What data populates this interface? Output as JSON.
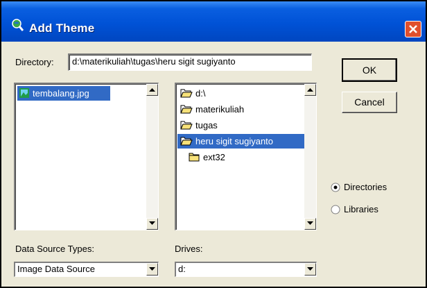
{
  "window": {
    "title": "Add Theme",
    "icon": "globe-search-icon",
    "accent": "#0052d6",
    "close_color": "#e0502d"
  },
  "directory": {
    "label": "Directory:",
    "value": "d:\\materikuliah\\tugas\\heru sigit sugiyanto"
  },
  "buttons": {
    "ok": "OK",
    "cancel": "Cancel"
  },
  "files": [
    {
      "label": "tembalang.jpg",
      "icon": "image-file-icon",
      "selected": true
    }
  ],
  "folders": [
    {
      "label": "d:\\",
      "icon": "open-folder-icon",
      "selected": false
    },
    {
      "label": "materikuliah",
      "icon": "open-folder-icon",
      "selected": false
    },
    {
      "label": "tugas",
      "icon": "open-folder-icon",
      "selected": false
    },
    {
      "label": "heru sigit sugiyanto",
      "icon": "open-folder-icon",
      "selected": true
    },
    {
      "label": "ext32",
      "icon": "closed-folder-icon",
      "selected": false
    }
  ],
  "view_mode": {
    "directories": "Directories",
    "libraries": "Libraries",
    "selected": "Directories"
  },
  "data_source": {
    "label": "Data Source Types:",
    "value": "Image Data Source"
  },
  "drives": {
    "label": "Drives:",
    "value": "d:"
  }
}
